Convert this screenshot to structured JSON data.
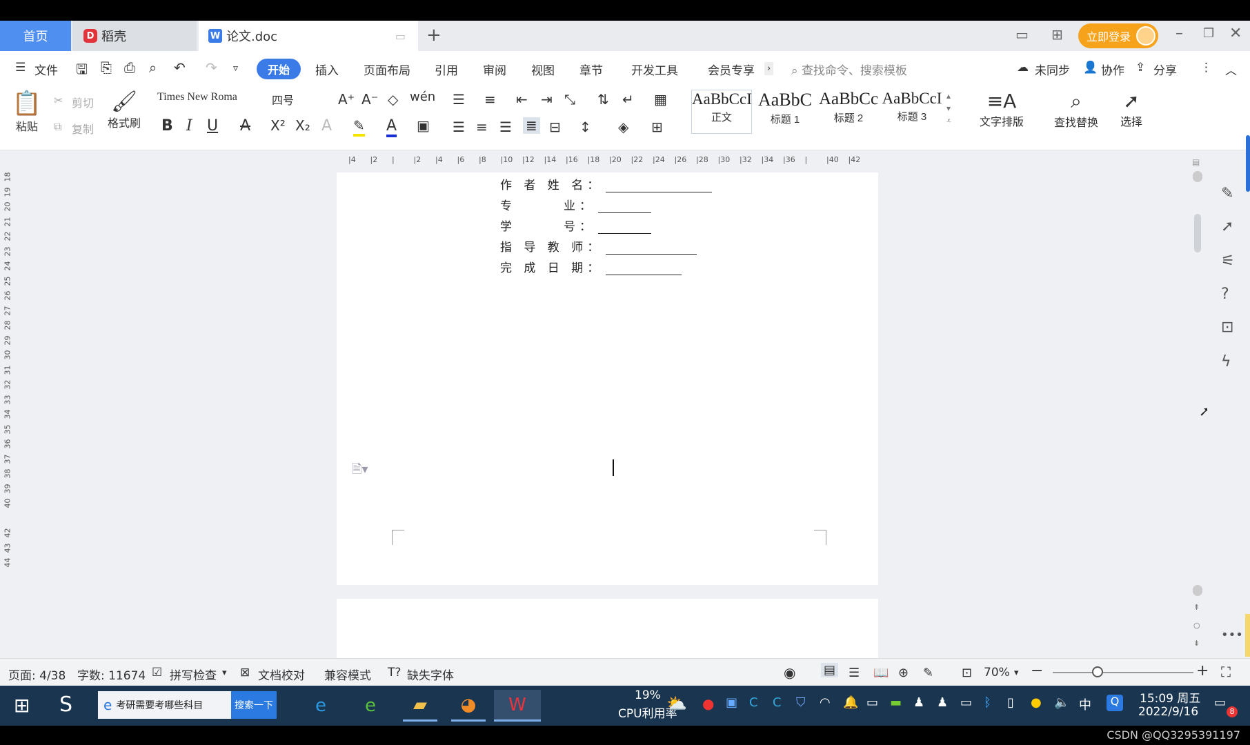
{
  "tabs": {
    "home": "首页",
    "docer": "稻壳",
    "doc": "论文.doc",
    "login": "立即登录"
  },
  "menu": {
    "file": "文件",
    "items": [
      "开始",
      "插入",
      "页面布局",
      "引用",
      "审阅",
      "视图",
      "章节",
      "开发工具",
      "会员专享"
    ],
    "search_placeholder": "查找命令、搜索模板",
    "unsynced": "未同步",
    "collaborate": "协作",
    "share": "分享"
  },
  "ribbon": {
    "paste": "粘贴",
    "cut": "剪切",
    "copy": "复制",
    "format_painter": "格式刷",
    "font_name": "Times New Roma",
    "font_size": "四号",
    "styles": [
      {
        "preview": "AaBbCcI",
        "label": "正文"
      },
      {
        "preview": "AaBbC",
        "label": "标题 1"
      },
      {
        "preview": "AaBbCc",
        "label": "标题 2"
      },
      {
        "preview": "AaBbCcI",
        "label": "标题 3"
      }
    ],
    "text_layout": "文字排版",
    "find_replace": "查找替换",
    "select": "选择"
  },
  "ruler": {
    "h_ticks": [
      "4",
      "2",
      "",
      "2",
      "4",
      "6",
      "8",
      "10",
      "12",
      "14",
      "16",
      "18",
      "20",
      "22",
      "24",
      "26",
      "28",
      "30",
      "32",
      "34",
      "36",
      "",
      "40",
      "42"
    ],
    "v_ticks": [
      "18",
      "19",
      "20",
      "21",
      "22",
      "23",
      "24",
      "25",
      "26",
      "27",
      "28",
      "29",
      "30",
      "31",
      "32",
      "33",
      "34",
      "35",
      "36",
      "37",
      "38",
      "39",
      "40",
      "",
      "42",
      "43",
      "44"
    ]
  },
  "document": {
    "fields": [
      {
        "label": "作 者 姓 名：",
        "blank_chars": 14
      },
      {
        "label": "专　　　业：",
        "blank_chars": 7
      },
      {
        "label": "学　　　号：",
        "blank_chars": 7
      },
      {
        "label": "指 导 教 师：",
        "blank_chars": 12
      },
      {
        "label": "完 成 日 期：",
        "blank_chars": 10
      }
    ]
  },
  "status": {
    "page": "页面: 4/38",
    "words": "字数: 11674",
    "spell_check": "拼写检查",
    "doc_proof": "文档校对",
    "compat_mode": "兼容模式",
    "missing_fonts": "缺失字体",
    "zoom": "70%"
  },
  "taskbar": {
    "search_text": "考研需要考哪些科目",
    "search_button": "搜索一下",
    "cpu_percent": "19%",
    "cpu_label": "CPU利用率",
    "ime": "中",
    "time": "15:09 周五",
    "date": "2022/9/16",
    "notification_count": "8"
  },
  "watermark": "CSDN @QQ3295391197"
}
